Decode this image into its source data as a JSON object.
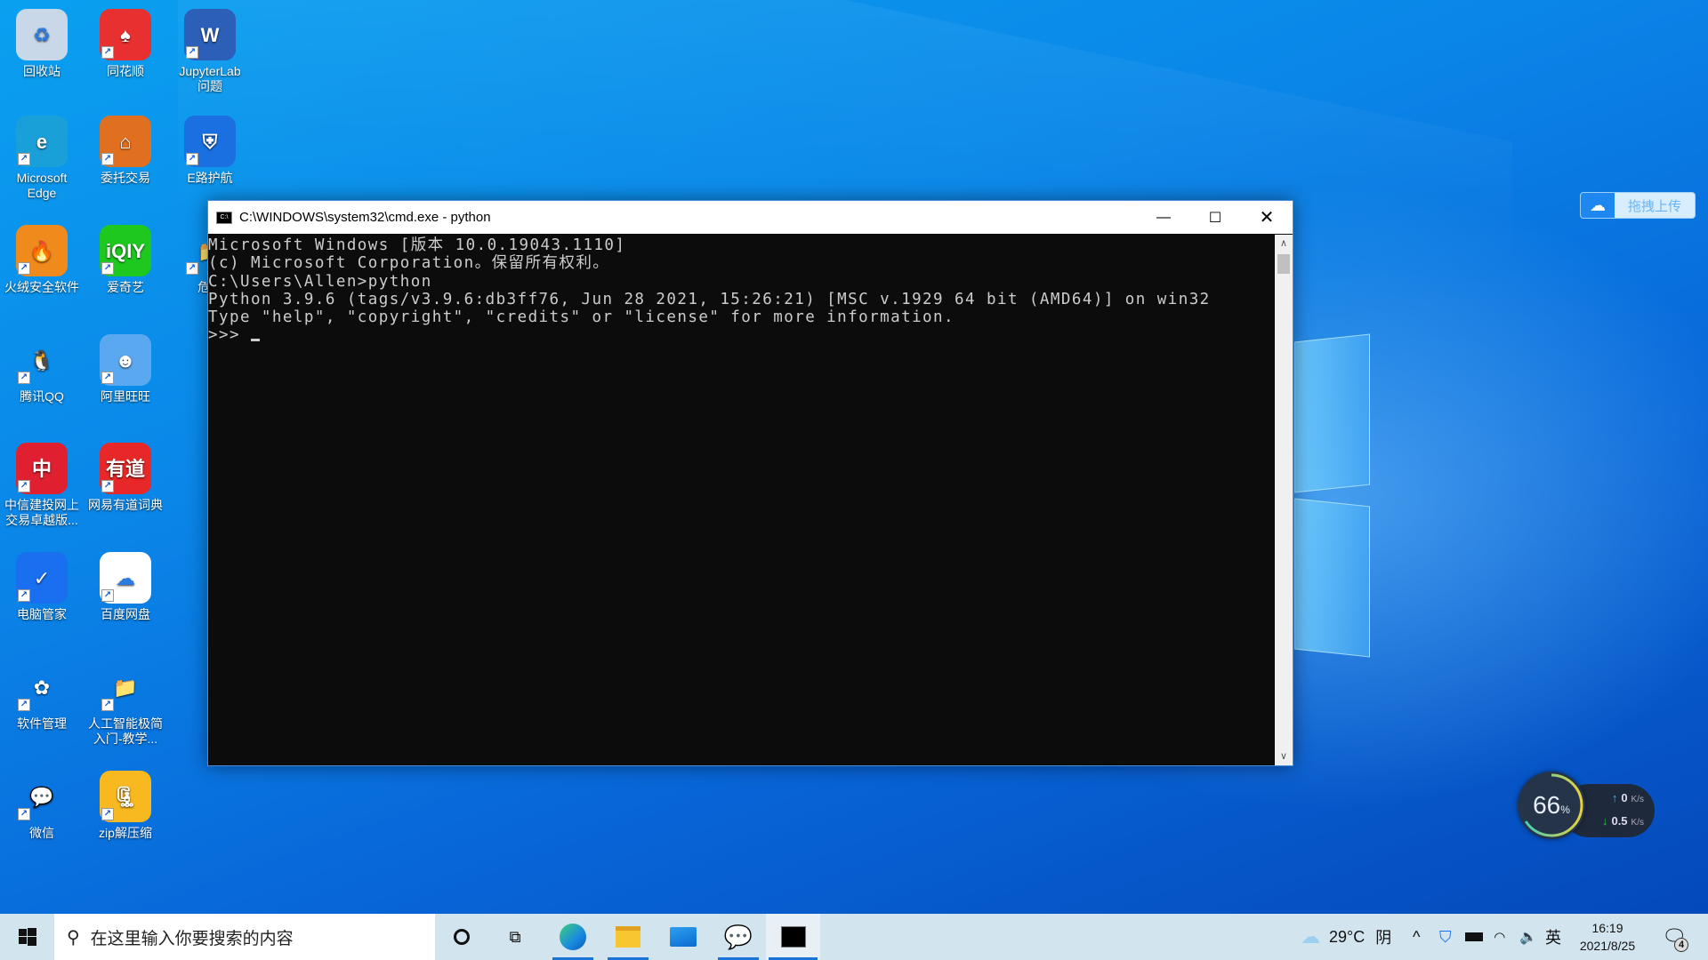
{
  "desktop": {
    "icons": [
      {
        "label": "回收站",
        "glyph": "♻",
        "color": "#c8d8e8",
        "icon": "recycle-bin-icon"
      },
      {
        "label": "Microsoft\nEdge",
        "glyph": "e",
        "color": "#1aa0d8",
        "icon": "edge-icon"
      },
      {
        "label": "火绒安全软件",
        "glyph": "🔥",
        "color": "#f08a1c",
        "icon": "huorong-icon"
      },
      {
        "label": "腾讯QQ",
        "glyph": "🐧",
        "color": "transparent",
        "icon": "qq-icon"
      },
      {
        "label": "中信建投网上\n交易卓越版...",
        "glyph": "中",
        "color": "#e02030",
        "icon": "citic-icon"
      },
      {
        "label": "电脑管家",
        "glyph": "✓",
        "color": "#1a6ef0",
        "icon": "pc-manager-icon"
      },
      {
        "label": "软件管理",
        "glyph": "✿",
        "color": "transparent",
        "icon": "software-manager-icon"
      },
      {
        "label": "微信",
        "glyph": "💬",
        "color": "transparent",
        "icon": "wechat-icon"
      },
      {
        "label": "同花顺",
        "glyph": "♠",
        "color": "#e83030",
        "icon": "tonghuashun-icon"
      },
      {
        "label": "委托交易",
        "glyph": "⌂",
        "color": "#e07020",
        "icon": "trade-icon"
      },
      {
        "label": "爱奇艺",
        "glyph": "iQIY",
        "color": "#1ec81e",
        "icon": "iqiyi-icon"
      },
      {
        "label": "阿里旺旺",
        "glyph": "☻",
        "color": "#5aa8f0",
        "icon": "aliwangwang-icon"
      },
      {
        "label": "网易有道词典",
        "glyph": "有道",
        "color": "#e82828",
        "icon": "youdao-icon"
      },
      {
        "label": "百度网盘",
        "glyph": "☁",
        "color": "#ffffff",
        "icon": "baidu-netdisk-icon"
      },
      {
        "label": "人工智能极简\n入门-教学...",
        "glyph": "📁",
        "color": "transparent",
        "icon": "folder-icon"
      },
      {
        "label": "zip解压缩",
        "glyph": "🗜",
        "color": "#f8b820",
        "icon": "zip-icon"
      },
      {
        "label": "JupyterLab\n问题",
        "glyph": "W",
        "color": "#2b5fb8",
        "icon": "word-doc-icon"
      },
      {
        "label": "E路护航",
        "glyph": "⛨",
        "color": "#1a70e0",
        "icon": "elu-icon"
      },
      {
        "label": "危险",
        "glyph": "📁",
        "color": "transparent",
        "icon": "folder-icon"
      }
    ]
  },
  "cmd": {
    "title": "C:\\WINDOWS\\system32\\cmd.exe - python",
    "lines": [
      "Microsoft Windows [版本 10.0.19043.1110]",
      "(c) Microsoft Corporation。保留所有权利。",
      "",
      "C:\\Users\\Allen>python",
      "Python 3.9.6 (tags/v3.9.6:db3ff76, Jun 28 2021, 15:26:21) [MSC v.1929 64 bit (AMD64)] on win32",
      "Type \"help\", \"copyright\", \"credits\" or \"license\" for more information.",
      ">>> "
    ]
  },
  "baidu_upload": {
    "label": "拖拽上传"
  },
  "net_widget": {
    "percent": "66",
    "percent_unit": "%",
    "up": "0",
    "down": "0.5",
    "unit": "K/s",
    "percent_value": 66
  },
  "taskbar": {
    "search_placeholder": "在这里输入你要搜索的内容",
    "weather_temp": "29°C",
    "weather_desc": "阴",
    "ime": "英",
    "time": "16:19",
    "date": "2021/8/25",
    "notifications": "4"
  },
  "colors": {
    "accent": "#1a74d8",
    "console_bg": "#0c0c0c",
    "console_fg": "#cccccc"
  }
}
